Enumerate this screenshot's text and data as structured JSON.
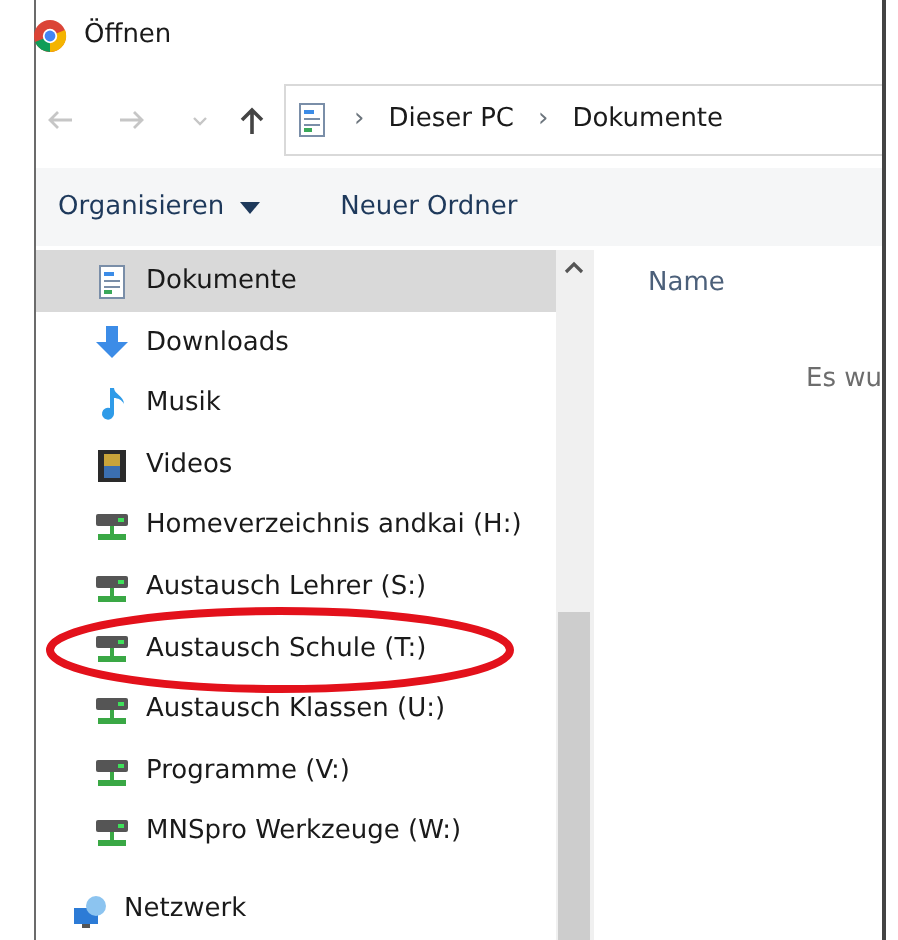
{
  "window": {
    "title": "Öffnen"
  },
  "address_bar": {
    "path": [
      "Dieser PC",
      "Dokumente"
    ],
    "separator": "›"
  },
  "toolbar": {
    "organize": "Organisieren",
    "new_folder": "Neuer Ordner"
  },
  "sidebar": {
    "items": [
      {
        "label": "Dokumente",
        "kind": "document",
        "selected": true,
        "circled": false
      },
      {
        "label": "Downloads",
        "kind": "download",
        "selected": false,
        "circled": false
      },
      {
        "label": "Musik",
        "kind": "music",
        "selected": false,
        "circled": false
      },
      {
        "label": "Videos",
        "kind": "video",
        "selected": false,
        "circled": false
      },
      {
        "label": "Homeverzeichnis andkai (H:)",
        "kind": "drive",
        "selected": false,
        "circled": false
      },
      {
        "label": "Austausch Lehrer (S:)",
        "kind": "drive",
        "selected": false,
        "circled": false
      },
      {
        "label": "Austausch Schule (T:)",
        "kind": "drive",
        "selected": false,
        "circled": true
      },
      {
        "label": "Austausch Klassen (U:)",
        "kind": "drive",
        "selected": false,
        "circled": false
      },
      {
        "label": "Programme (V:)",
        "kind": "drive",
        "selected": false,
        "circled": false
      },
      {
        "label": "MNSpro Werkzeuge (W:)",
        "kind": "drive",
        "selected": false,
        "circled": false
      }
    ],
    "network": {
      "label": "Netzwerk"
    }
  },
  "file_list": {
    "column_header": "Name",
    "empty_message": "Es wu"
  }
}
